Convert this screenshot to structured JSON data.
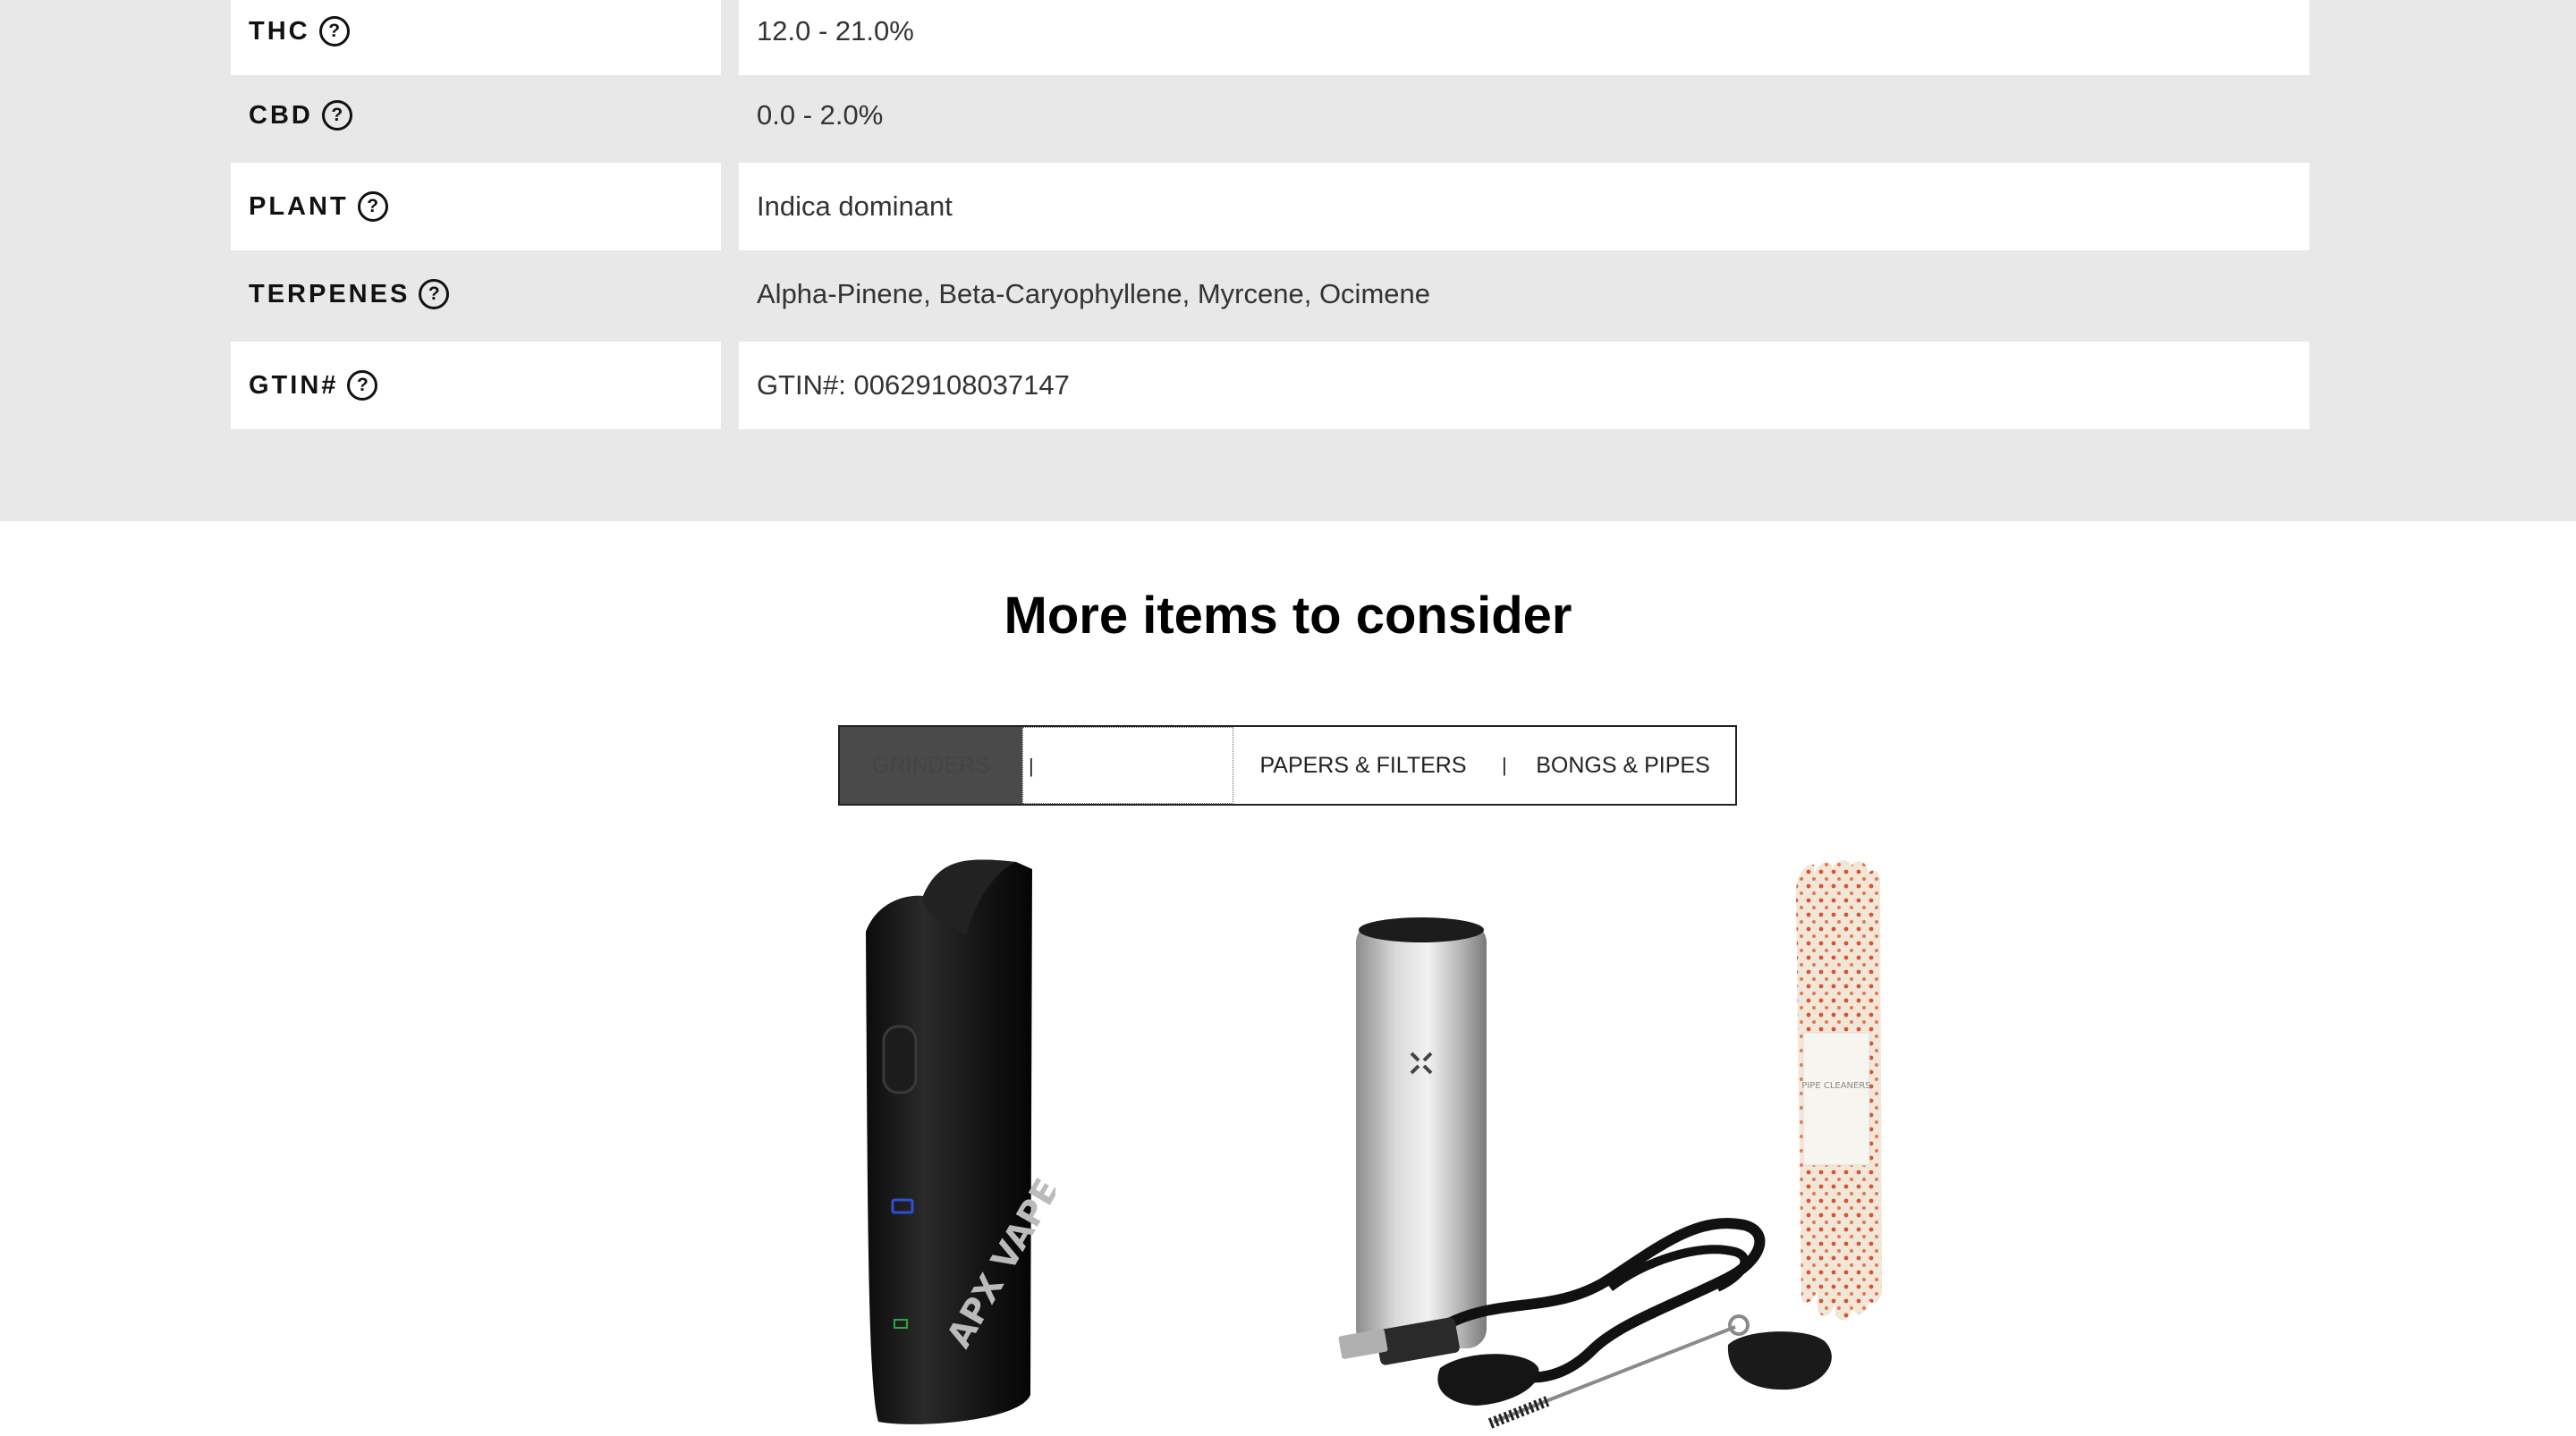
{
  "specs": [
    {
      "label": "THC",
      "value": "12.0 - 21.0%"
    },
    {
      "label": "CBD",
      "value": "0.0 - 2.0%"
    },
    {
      "label": "PLANT",
      "value": "Indica dominant"
    },
    {
      "label": "TERPENES",
      "value": "Alpha-Pinene, Beta-Caryophyllene, Myrcene, Ocimene"
    },
    {
      "label": "GTIN#",
      "value": "GTIN#: 00629108037147"
    }
  ],
  "help_icon_glyph": "?",
  "section_title": "More items to consider",
  "tabs": {
    "grinders": "GRINDERS",
    "separator": "|",
    "papers": "PAPERS & FILTERS",
    "bongs": "BONGS & PIPES"
  },
  "products": [
    {
      "image": "black-vaporizer",
      "brand_mark": "APX VAPE"
    },
    {
      "image": "silver-vaporizer-kit"
    },
    {
      "image": "pipe-cleaners",
      "package_text": "PIPE CLEANERS"
    }
  ]
}
